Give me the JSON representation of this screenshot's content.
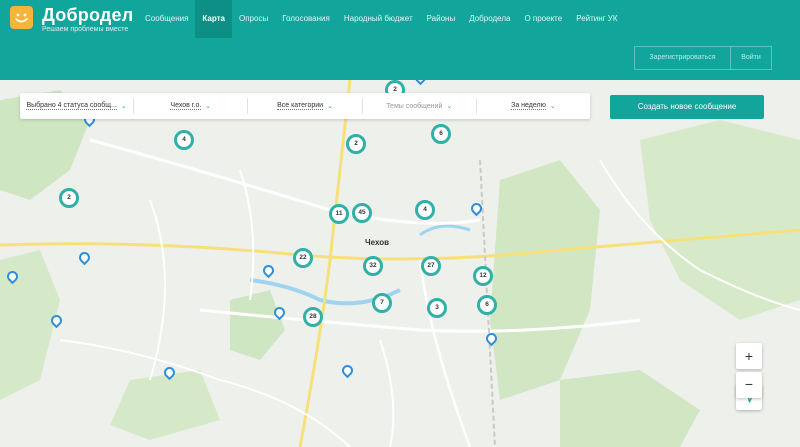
{
  "brand": {
    "name": "Добродел",
    "tagline": "Решаем проблемы вместе"
  },
  "nav": [
    {
      "label": "Сообщения",
      "active": false
    },
    {
      "label": "Карта",
      "active": true
    },
    {
      "label": "Опросы",
      "active": false
    },
    {
      "label": "Голосования",
      "active": false
    },
    {
      "label": "Народный бюджет",
      "active": false
    },
    {
      "label": "Районы",
      "active": false
    },
    {
      "label": "Добродела",
      "active": false
    },
    {
      "label": "О проекте",
      "active": false
    },
    {
      "label": "Рейтинг УК",
      "active": false
    }
  ],
  "auth": {
    "register": "Зарегистрироваться",
    "login": "Войти"
  },
  "filters": [
    {
      "label": "Выбрано 4 статуса сообщ...",
      "style": "under"
    },
    {
      "label": "Чехов г.о.",
      "style": "under"
    },
    {
      "label": "Все категории",
      "style": "under"
    },
    {
      "label": "Темы сообщений",
      "style": "muted"
    },
    {
      "label": "За неделю",
      "style": "under"
    }
  ],
  "create_button": "Создать новое сообщение",
  "map": {
    "city_label": "Чехов",
    "clusters": [
      "2",
      "4",
      "6",
      "2",
      "2",
      "11",
      "45",
      "4",
      "22",
      "32",
      "27",
      "12",
      "7",
      "3",
      "6",
      "28"
    ],
    "place_labels": [
      "Чехов"
    ]
  },
  "controls": {
    "zoom_in": "+",
    "zoom_out": "−"
  },
  "colors": {
    "accent": "#12a59b",
    "cluster_ring": "#2fb1a7",
    "pin": "#2f8fd6"
  }
}
